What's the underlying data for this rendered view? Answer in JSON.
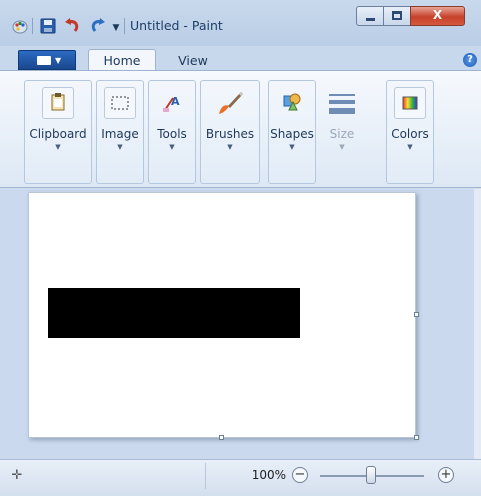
{
  "window": {
    "title": "Untitled - Paint",
    "close_glyph": "X"
  },
  "quick_access": {
    "dropdown_glyph": "▼"
  },
  "ribbon": {
    "tabs": [
      {
        "label": "Home",
        "selected": true
      },
      {
        "label": "View",
        "selected": false
      }
    ],
    "help_glyph": "?",
    "groups": [
      {
        "label": "Clipboard",
        "icon": "clipboard-icon",
        "enabled": true
      },
      {
        "label": "Image",
        "icon": "image-select-icon",
        "enabled": true
      },
      {
        "label": "Tools",
        "icon": "tools-icon",
        "enabled": true
      },
      {
        "label": "Brushes",
        "icon": "brush-icon",
        "enabled": true
      },
      {
        "label": "Shapes",
        "icon": "shapes-icon",
        "enabled": true
      },
      {
        "label": "Size",
        "icon": "size-lines-icon",
        "enabled": false
      },
      {
        "label": "Colors",
        "icon": "colors-icon",
        "enabled": true
      }
    ],
    "arrow_glyph": "▼"
  },
  "canvas": {
    "background": "#ffffff",
    "shape": {
      "type": "rectangle",
      "fill": "#000000"
    }
  },
  "statusbar": {
    "cursor_icon": "move-cross-icon",
    "zoom_label": "100%",
    "zoom_out_glyph": "−",
    "zoom_in_glyph": "+"
  },
  "colors": {
    "title_bar": "#c9d9ec",
    "file_menu": "#2d6bc3",
    "close_button": "#c7412a",
    "workspace": "#cad9ed"
  }
}
